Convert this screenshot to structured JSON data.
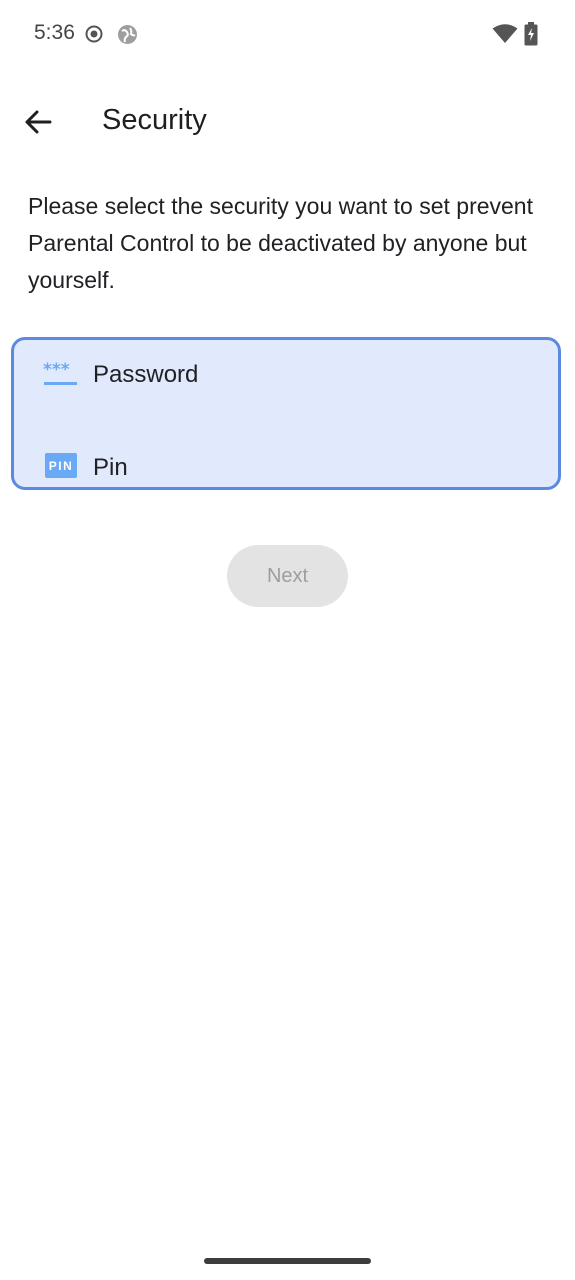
{
  "status_bar": {
    "time": "5:36",
    "icons": [
      "record-icon",
      "globe-icon",
      "wifi-icon",
      "battery-charging-icon"
    ]
  },
  "app_bar": {
    "back_icon": "arrow-back-icon",
    "title": "Security"
  },
  "description": "Please select the security you want to set prevent Parental Control to be deactivated by anyone but yourself.",
  "options": [
    {
      "label": "Password",
      "icon": "password-dots-icon"
    },
    {
      "label": "Pin",
      "icon": "pin-badge-icon",
      "badge_text": "PIN"
    }
  ],
  "next_button": {
    "label": "Next",
    "enabled": false
  },
  "colors": {
    "card_background": "#e1eafc",
    "card_border": "#5b8be0",
    "icon_blue": "#6aa9f5",
    "button_disabled_bg": "#e3e3e3",
    "button_disabled_text": "#9e9e9e"
  }
}
